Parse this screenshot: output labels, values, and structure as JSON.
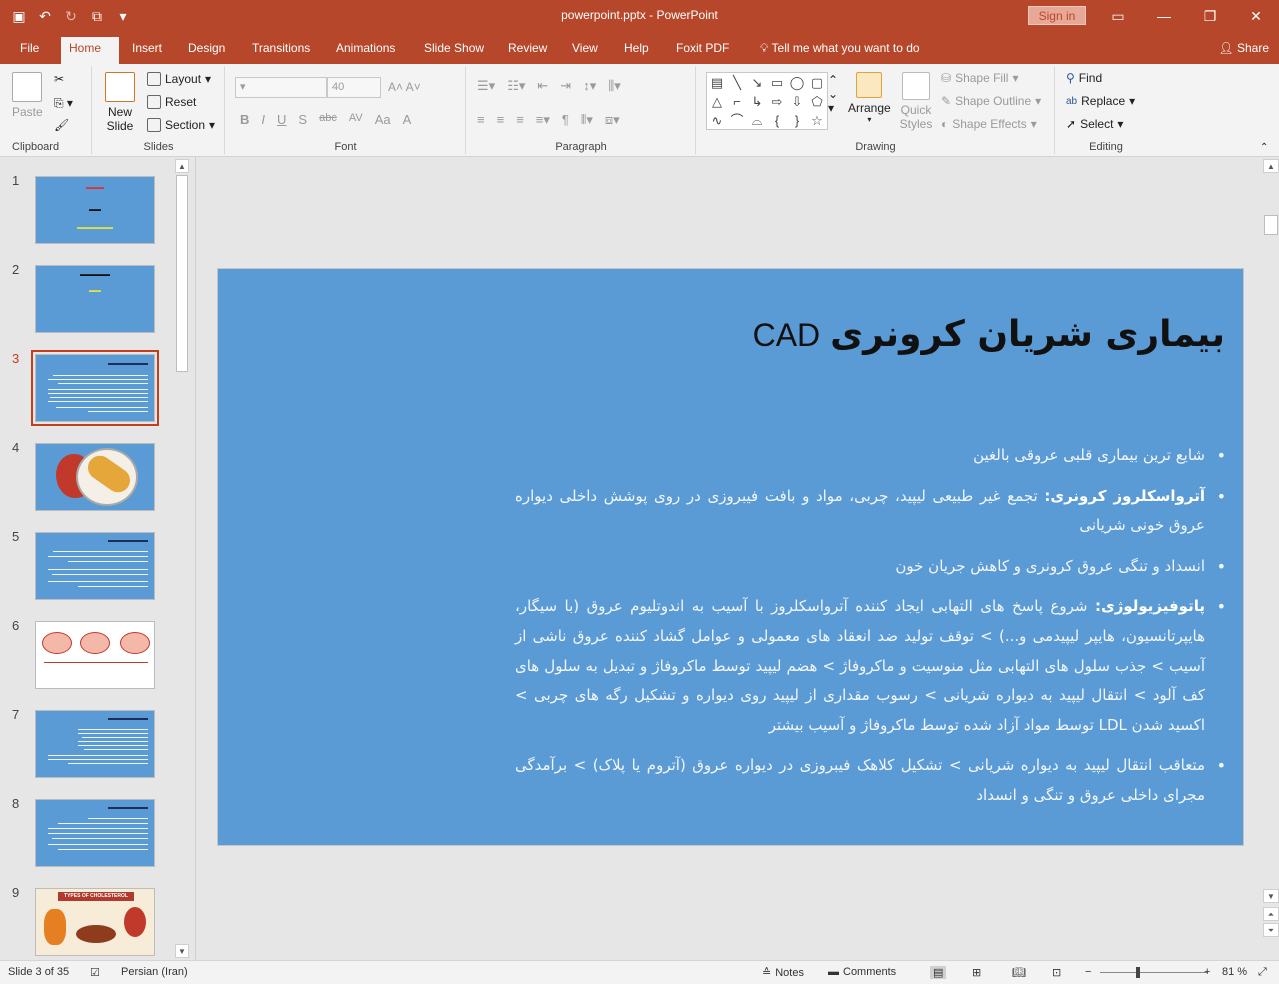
{
  "titlebar": {
    "document_title": "powerpoint.pptx  -  PowerPoint",
    "signin_label": "Sign in",
    "qat_icons": [
      "save-icon",
      "undo-icon",
      "redo-icon",
      "presentation-icon",
      "customize-icon"
    ]
  },
  "menu": {
    "tabs": [
      "File",
      "Home",
      "Insert",
      "Design",
      "Transitions",
      "Animations",
      "Slide Show",
      "Review",
      "View",
      "Help",
      "Foxit PDF",
      "Tell me what you want to do"
    ],
    "active_tab": "Home",
    "share_label": "Share"
  },
  "ribbon": {
    "clipboard": {
      "label": "Clipboard",
      "paste": "Paste"
    },
    "slides": {
      "label": "Slides",
      "new_slide": "New Slide",
      "layout": "Layout",
      "reset": "Reset",
      "section": "Section"
    },
    "font": {
      "label": "Font",
      "font_size": "40",
      "buttons": [
        "B",
        "I",
        "U",
        "S",
        "abc",
        "AV",
        "Aa",
        "A"
      ]
    },
    "paragraph": {
      "label": "Paragraph"
    },
    "drawing": {
      "label": "Drawing",
      "arrange": "Arrange",
      "quick_styles": "Quick Styles",
      "shape_fill": "Shape Fill",
      "shape_outline": "Shape Outline",
      "shape_effects": "Shape Effects"
    },
    "editing": {
      "label": "Editing",
      "find": "Find",
      "replace": "Replace",
      "select": "Select"
    }
  },
  "thumbnails": {
    "numbers": [
      "1",
      "2",
      "3",
      "4",
      "5",
      "6",
      "7",
      "8",
      "9"
    ],
    "selected": "3",
    "slide9_caption": "TYPES OF CHOLESTEROL"
  },
  "slide": {
    "title_fa": "بیماری شریان کرونری",
    "title_en": "CAD",
    "bullets": [
      {
        "keyword": "",
        "text": "شایع ترین بیماری قلبی عروقی بالغین"
      },
      {
        "keyword": "آترواسکلروز کرونری:",
        "text": " تجمع غیر طبیعی لیپید، چربی، مواد و بافت فیبروزی در روی پوشش داخلی دیواره عروق خونی شریانی"
      },
      {
        "keyword": "",
        "text": "انسداد و تنگی عروق کرونری و کاهش جریان خون"
      },
      {
        "keyword": "پاتوفیزیولوژی:",
        "text": " شروع پاسخ های التهابی ایجاد کننده آترواسکلروز با آسیب به اندوتلیوم عروق (با سیگار، هایپرتانسیون، هایپر لیپیدمی و...) > توقف تولید ضد انعقاد های معمولی و عوامل گشاد کننده عروق ناشی از آسیب > جذب سلول های التهابی مثل منوسیت و ماکروفاژ > هضم لیپید توسط ماکروفاژ و تبدیل به سلول های کف آلود > انتقال لیپید به دیواره شریانی > رسوب مقداری از لیپید روی دیواره و تشکیل رگه های چربی > اکسید شدن LDL توسط مواد آزاد شده توسط ماکروفاژ و آسیب بیشتر"
      },
      {
        "keyword": "",
        "text": "متعاقب انتقال لیپید به دیواره شریانی > تشکیل کلاهک فیبروزی در دیواره عروق (آتروم یا پلاک) > برآمدگی مجرای داخلی عروق  و تنگی و انسداد"
      }
    ]
  },
  "statusbar": {
    "slide_info": "Slide 3 of 35",
    "language": "Persian (Iran)",
    "notes": "Notes",
    "comments": "Comments",
    "zoom": "81 %"
  },
  "colors": {
    "accent": "#b7472a",
    "slide_background": "#5b9bd5",
    "selected_thumb": "#c43e1c"
  }
}
